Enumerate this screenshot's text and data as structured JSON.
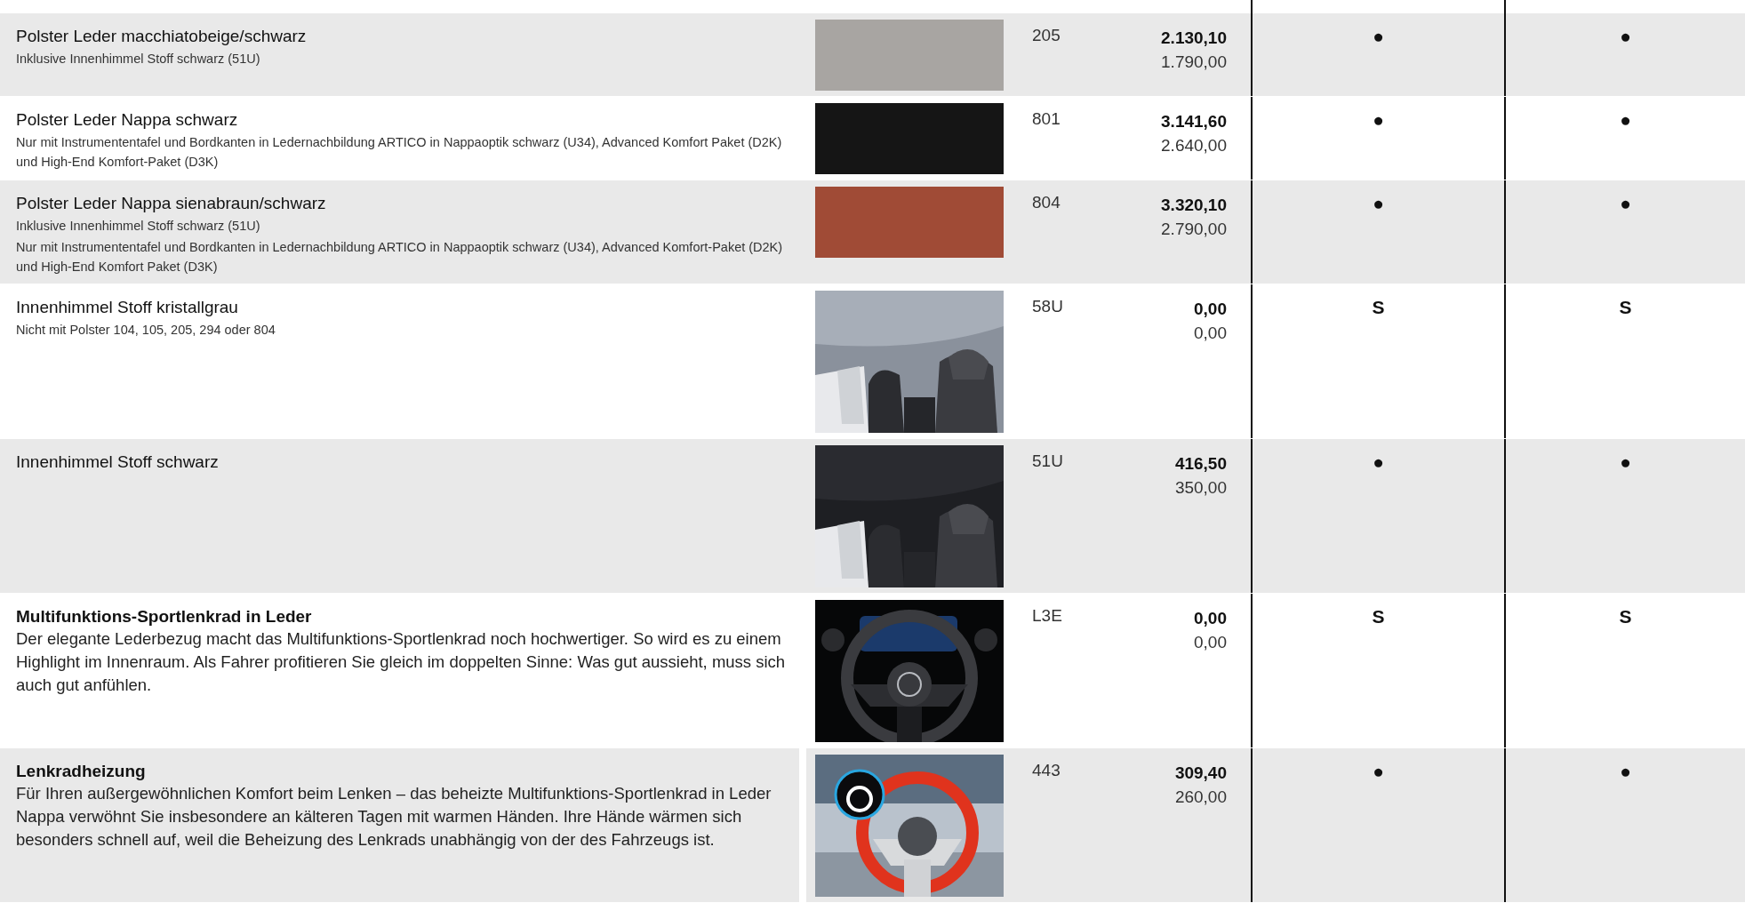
{
  "rows": [
    {
      "title": "Polster Leder macchiatobeige/schwarz",
      "notes": [
        "Inklusive Innenhimmel Stoff schwarz (51U)"
      ],
      "image": {
        "kind": "swatch",
        "color": "#a8a5a2"
      },
      "code": "205",
      "price_gross": "2.130,10",
      "price_net": "1.790,00",
      "column_1": "●",
      "column_2": "●"
    },
    {
      "title": "Polster Leder Nappa schwarz",
      "notes": [
        "Nur mit Instrumententafel und Bordkanten in Ledernachbildung ARTICO in Nappaoptik schwarz (U34), Advanced Komfort Paket (D2K) und High-End Komfort-Paket (D3K)"
      ],
      "image": {
        "kind": "swatch",
        "color": "#151515"
      },
      "code": "801",
      "price_gross": "3.141,60",
      "price_net": "2.640,00",
      "column_1": "●",
      "column_2": "●"
    },
    {
      "title": "Polster Leder Nappa sienabraun/schwarz",
      "notes": [
        "Inklusive Innenhimmel Stoff schwarz (51U)",
        "Nur mit Instrumententafel und Bordkanten in Ledernachbildung ARTICO in Nappaoptik schwarz (U34), Advanced Komfort-Paket (D2K) und High-End Komfort Paket (D3K)"
      ],
      "image": {
        "kind": "swatch",
        "color": "#a04b36"
      },
      "code": "804",
      "price_gross": "3.320,10",
      "price_net": "2.790,00",
      "column_1": "●",
      "column_2": "●"
    },
    {
      "title": "Innenhimmel Stoff kristallgrau",
      "notes": [
        "Nicht mit Polster 104, 105, 205, 294 oder 804"
      ],
      "image": {
        "kind": "picture"
      },
      "code": "58U",
      "price_gross": "0,00",
      "price_net": "0,00",
      "column_1": "S",
      "column_2": "S"
    },
    {
      "title": "Innenhimmel Stoff schwarz",
      "image": {
        "kind": "picture"
      },
      "code": "51U",
      "price_gross": "416,50",
      "price_net": "350,00",
      "column_1": "●",
      "column_2": "●"
    },
    {
      "title": "Multifunktions-Sportlenkrad in Leder",
      "description": "Der elegante Lederbezug macht das Multifunktions-Sportlenkrad noch hochwertiger. So wird es zu einem Highlight im Innenraum. Als Fahrer profitieren Sie gleich im doppelten Sinne: Was gut aussieht, muss sich auch gut anfühlen.",
      "image": {
        "kind": "picture"
      },
      "code": "L3E",
      "price_gross": "0,00",
      "price_net": "0,00",
      "column_1": "S",
      "column_2": "S"
    },
    {
      "title": "Lenkradheizung",
      "description": "Für Ihren außergewöhnlichen Komfort beim Lenken – das beheizte Multifunktions-Sportlenkrad in Leder Nappa verwöhnt Sie insbesondere an kälteren Tagen mit warmen Händen. Ihre Hände wärmen sich besonders schnell auf, weil die Beheizung des Lenkrads unabhängig von der des Fahrzeugs ist.",
      "image": {
        "kind": "picture"
      },
      "code": "443",
      "price_gross": "309,40",
      "price_net": "260,00",
      "column_1": "●",
      "column_2": "●"
    }
  ]
}
